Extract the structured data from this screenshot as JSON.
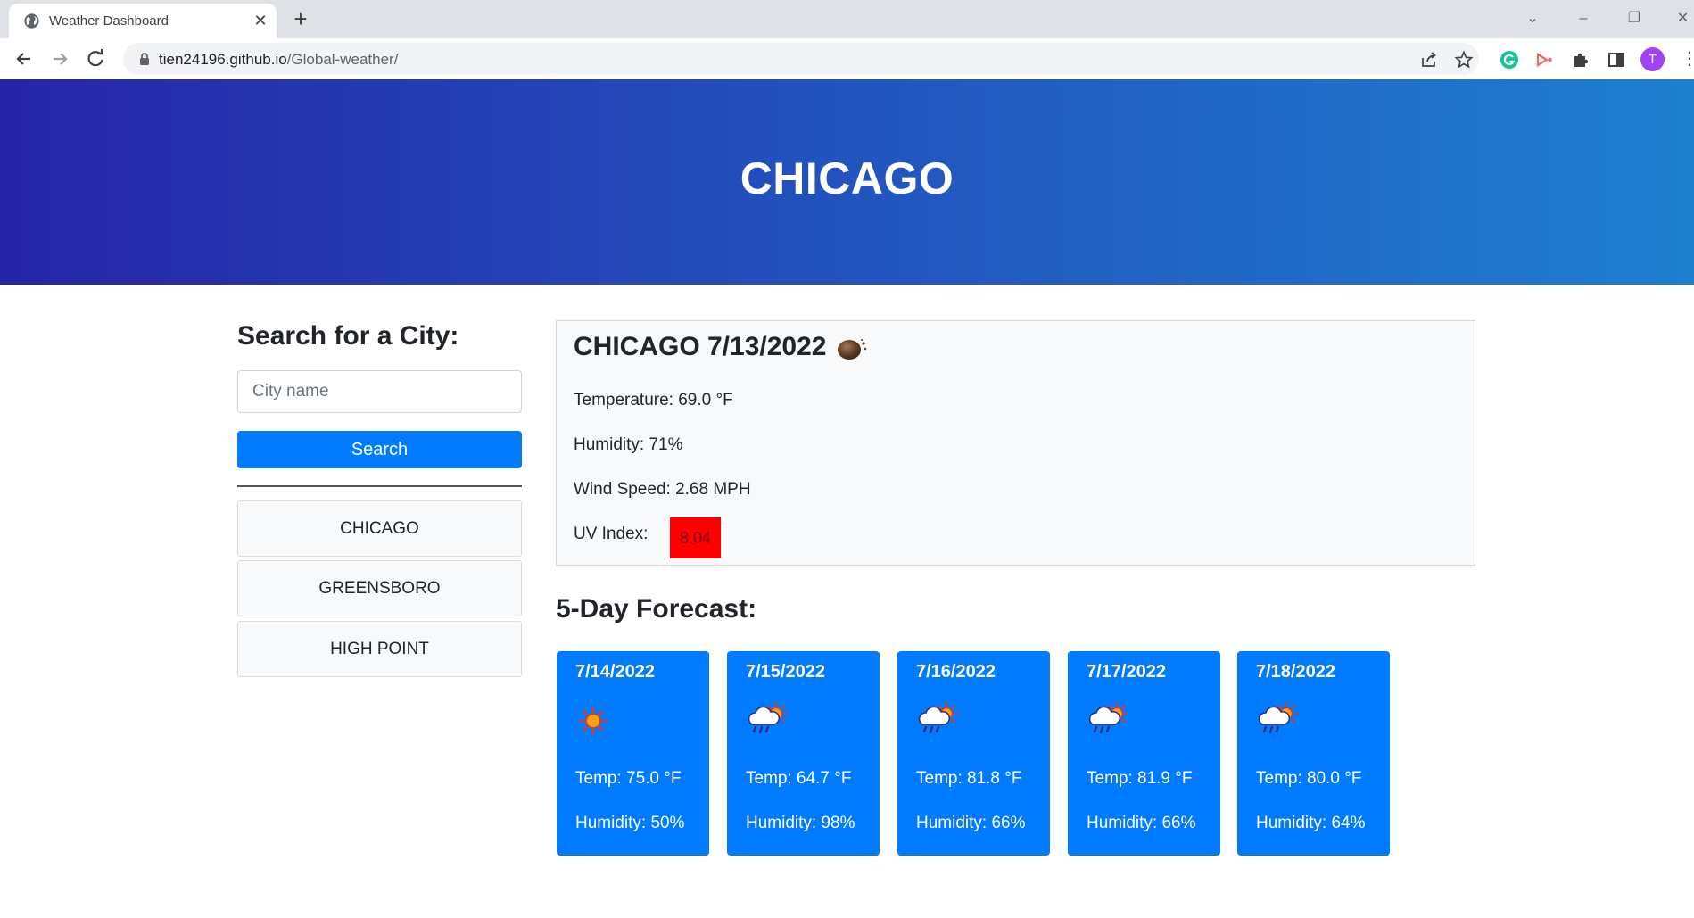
{
  "browser": {
    "tab_title": "Weather Dashboard",
    "url_host": "tien24196.github.io",
    "url_path": "/Global-weather/",
    "avatar_initial": "T"
  },
  "header": {
    "title": "CHICAGO"
  },
  "sidebar": {
    "title": "Search for a City:",
    "input_placeholder": "City name",
    "input_value": "",
    "search_label": "Search",
    "history": [
      "CHICAGO",
      "GREENSBORO",
      "HIGH POINT"
    ]
  },
  "today": {
    "heading": "CHICAGO 7/13/2022",
    "icon": "night-clear-moon-icon",
    "temperature": "Temperature: 69.0 °F",
    "humidity": "Humidity: 71%",
    "wind": "Wind Speed: 2.68 MPH",
    "uv_label": "UV Index:",
    "uv_value": "8.04",
    "uv_color": "#ff0000"
  },
  "forecast": {
    "title": "5-Day Forecast:",
    "days": [
      {
        "date": "7/14/2022",
        "icon": "sun-icon",
        "temp": "Temp: 75.0 °F",
        "humidity": "Humidity: 50%"
      },
      {
        "date": "7/15/2022",
        "icon": "sun-rain-cloud-icon",
        "temp": "Temp: 64.7 °F",
        "humidity": "Humidity: 98%"
      },
      {
        "date": "7/16/2022",
        "icon": "sun-rain-cloud-icon",
        "temp": "Temp: 81.8 °F",
        "humidity": "Humidity: 66%"
      },
      {
        "date": "7/17/2022",
        "icon": "sun-rain-cloud-icon",
        "temp": "Temp: 81.9 °F",
        "humidity": "Humidity: 66%"
      },
      {
        "date": "7/18/2022",
        "icon": "sun-rain-cloud-icon",
        "temp": "Temp: 80.0 °F",
        "humidity": "Humidity: 64%"
      }
    ]
  },
  "colors": {
    "accent": "#007bff",
    "hero_start": "#2624a8",
    "hero_end": "#1e7fcf"
  }
}
